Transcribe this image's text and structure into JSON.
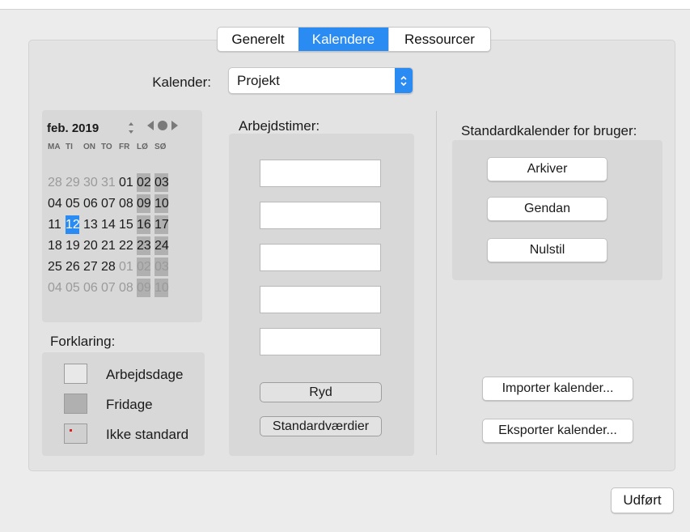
{
  "tabs": [
    {
      "label": "Generelt",
      "active": false
    },
    {
      "label": "Kalendere",
      "active": true
    },
    {
      "label": "Ressourcer",
      "active": false
    }
  ],
  "calendar_select": {
    "label": "Kalender:",
    "value": "Projekt"
  },
  "mini_calendar": {
    "month_label": "feb. 2019",
    "weekdays": [
      "MA",
      "TI",
      "ON",
      "TO",
      "FR",
      "LØ",
      "SØ"
    ],
    "weeks": [
      [
        "28",
        "29",
        "30",
        "31",
        "01",
        "02",
        "03"
      ],
      [
        "04",
        "05",
        "06",
        "07",
        "08",
        "09",
        "10"
      ],
      [
        "11",
        "12",
        "13",
        "14",
        "15",
        "16",
        "17"
      ],
      [
        "18",
        "19",
        "20",
        "21",
        "22",
        "23",
        "24"
      ],
      [
        "25",
        "26",
        "27",
        "28",
        "01",
        "02",
        "03"
      ],
      [
        "04",
        "05",
        "06",
        "07",
        "08",
        "09",
        "10"
      ]
    ],
    "today": "12"
  },
  "legend": {
    "title": "Forklaring:",
    "items": [
      "Arbejdsdage",
      "Fridage",
      "Ikke standard"
    ]
  },
  "work_hours": {
    "title": "Arbejdstimer:",
    "fields": [
      "",
      "",
      "",
      "",
      ""
    ],
    "clear_label": "Ryd",
    "defaults_label": "Standardværdier"
  },
  "user_defaults": {
    "title": "Standardkalender for bruger:",
    "archive_label": "Arkiver",
    "restore_label": "Gendan",
    "reset_label": "Nulstil"
  },
  "import_label": "Importer kalender...",
  "export_label": "Eksporter kalender...",
  "done_label": "Udført",
  "colors": {
    "accent": "#2a8bf2",
    "weekend": "#b0b0b0",
    "nonstandard_marker": "#e02020"
  }
}
